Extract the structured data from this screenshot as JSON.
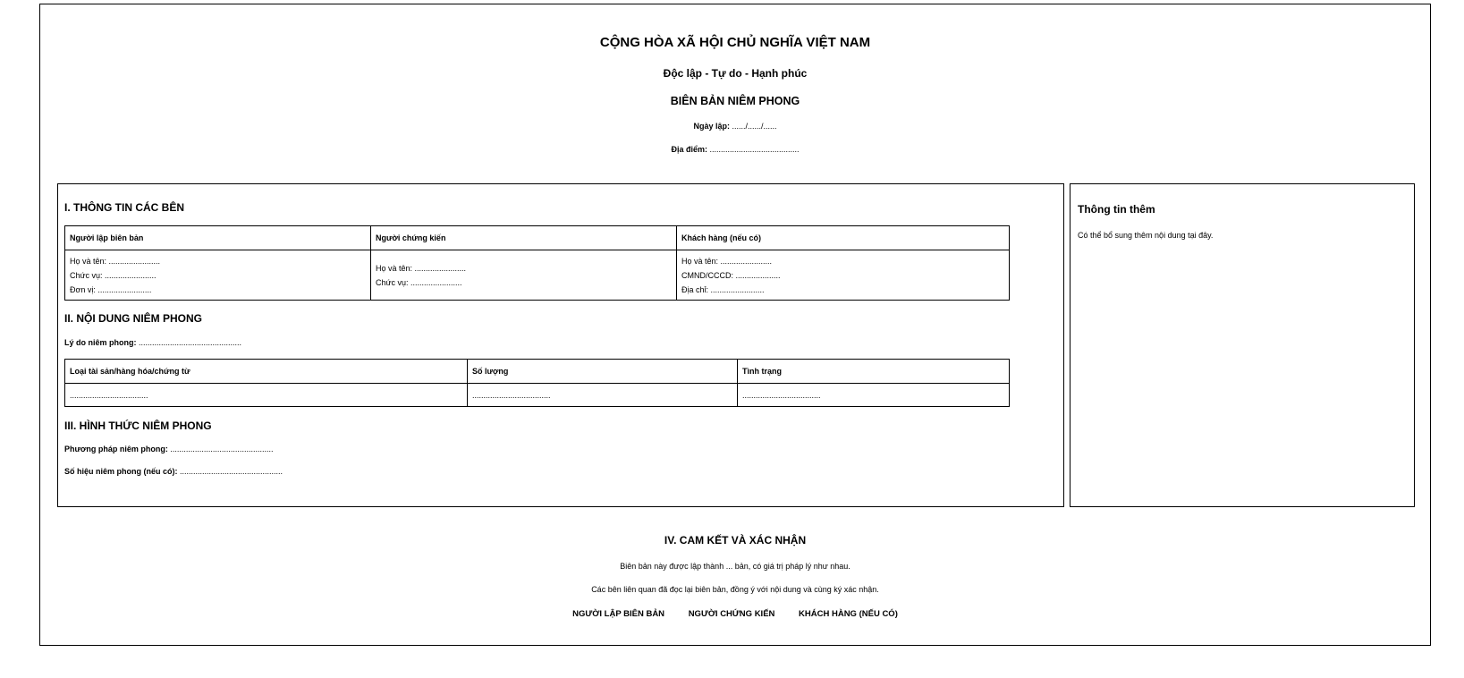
{
  "header": {
    "nation": "CỘNG HÒA XÃ HỘI CHỦ NGHĨA VIỆT NAM",
    "motto": "Độc lập - Tự do - Hạnh phúc",
    "title": "BIÊN BẢN NIÊM PHONG",
    "date_label": "Ngày lập:",
    "date_value": "....../....../......",
    "place_label": "Địa điểm:",
    "place_value": "........................................"
  },
  "section1": {
    "title": "I. THÔNG TIN CÁC BÊN",
    "columns": [
      "Người lập biên bản",
      "Người chứng kiến",
      "Khách hàng (nếu có)"
    ],
    "col1_lines": [
      "Họ và tên: .......................",
      "Chức vụ: .......................",
      "Đơn vị: ........................"
    ],
    "col2_lines": [
      "Họ và tên: .......................",
      "Chức vụ: ......................."
    ],
    "col3_lines": [
      "Họ và tên: .......................",
      "CMND/CCCD: ....................",
      "Địa chỉ: ........................"
    ]
  },
  "section2": {
    "title": "II. NỘI DUNG NIÊM PHONG",
    "reason_label": "Lý do niêm phong:",
    "reason_value": "..............................................",
    "columns": [
      "Loại tài sản/hàng hóa/chứng từ",
      "Số lượng",
      "Tình trạng"
    ],
    "row": [
      "...................................",
      "...................................",
      "..................................."
    ]
  },
  "section3": {
    "title": "III. HÌNH THỨC NIÊM PHONG",
    "method_label": "Phương pháp niêm phong:",
    "method_value": "..............................................",
    "seal_label": "Số hiệu niêm phong (nếu có):",
    "seal_value": ".............................................."
  },
  "side": {
    "title": "Thông tin thêm",
    "note": "Có thể bổ sung thêm nội dung tại đây."
  },
  "commitment": {
    "title": "IV. CAM KẾT VÀ XÁC NHẬN",
    "line1": "Biên bản này được lập thành ... bản, có giá trị pháp lý như nhau.",
    "line2": "Các bên liên quan đã đọc lại biên bản, đồng ý với nội dung và cùng ký xác nhận.",
    "signers": [
      "NGƯỜI LẬP BIÊN BẢN",
      "NGƯỜI CHỨNG KIẾN",
      "KHÁCH HÀNG (NẾU CÓ)"
    ]
  }
}
